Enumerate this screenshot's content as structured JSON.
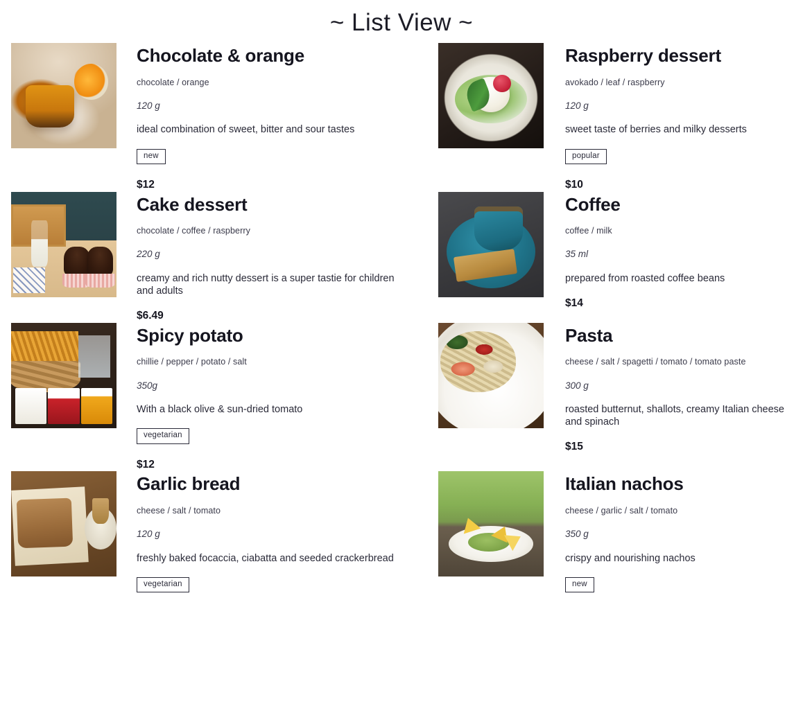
{
  "page": {
    "title": "~ List View ~"
  },
  "items": [
    {
      "name": "Chocolate & orange",
      "ingredients": "chocolate / orange",
      "weight": "120 g",
      "description": "ideal combination of sweet, bitter and sour tastes",
      "tag": "new",
      "price": "$12",
      "image_alt": "chocolate-orange-cake-photo"
    },
    {
      "name": "Raspberry dessert",
      "ingredients": "avokado / leaf / raspberry",
      "weight": "120 g",
      "description": "sweet taste of berries and milky desserts",
      "tag": "popular",
      "price": "$10",
      "image_alt": "raspberry-panna-cotta-photo"
    },
    {
      "name": "Cake dessert",
      "ingredients": "chocolate / coffee / raspberry",
      "weight": "220 g",
      "description": "creamy and rich nutty dessert is a super tastie for children and adults",
      "tag": "",
      "price": "$6.49",
      "image_alt": "chocolate-cupcakes-photo"
    },
    {
      "name": "Coffee",
      "ingredients": "coffee / milk",
      "weight": "35 ml",
      "description": "prepared from roasted coffee beans",
      "tag": "",
      "price": "$14",
      "image_alt": "coffee-cup-biscotti-photo"
    },
    {
      "name": "Spicy potato",
      "ingredients": "chillie / pepper / potato / salt",
      "weight": "350g",
      "description": "With a black olive & sun-dried tomato",
      "tag": "vegetarian",
      "price": "$12",
      "image_alt": "fries-basket-dips-photo"
    },
    {
      "name": "Pasta",
      "ingredients": "cheese / salt / spagetti / tomato / tomato paste",
      "weight": "300 g",
      "description": "roasted butternut, shallots, creamy Italian cheese and spinach",
      "tag": "",
      "price": "$15",
      "image_alt": "shrimp-pasta-plate-photo"
    },
    {
      "name": "Garlic bread",
      "ingredients": "cheese / salt / tomato",
      "weight": "120 g",
      "description": "freshly baked focaccia, ciabatta and seeded crackerbread",
      "tag": "vegetarian",
      "price": "",
      "image_alt": "garlic-bread-slice-photo"
    },
    {
      "name": "Italian nachos",
      "ingredients": "cheese / garlic / salt / tomato",
      "weight": "350 g",
      "description": "crispy and nourishing nachos",
      "tag": "new",
      "price": "",
      "image_alt": "nachos-guacamole-plate-photo"
    }
  ],
  "colors": {
    "background": "#ffffff",
    "text_primary": "#15151f",
    "text_secondary": "#3a3a4a",
    "tag_border": "#2a2a38"
  }
}
